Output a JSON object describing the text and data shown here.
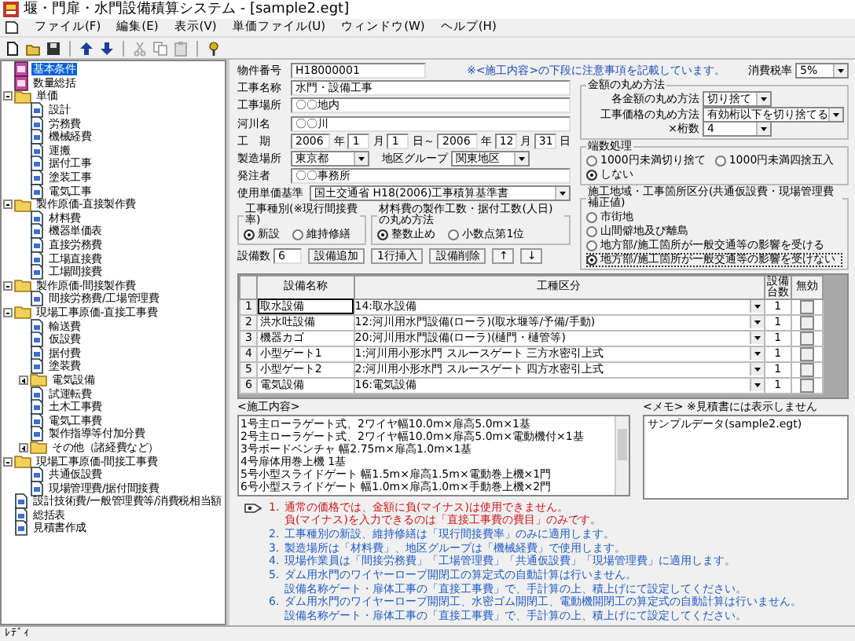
{
  "window": {
    "title": "堰・門扉・水門設備積算システム - [sample2.egt]"
  },
  "menu": [
    "ファイル(F)",
    "編集(E)",
    "表示(V)",
    "単価ファイル(U)",
    "ウィンドウ(W)",
    "ヘルプ(H)"
  ],
  "sidebar": {
    "items": [
      {
        "label": "基本条件",
        "kind": "sheet",
        "selected": true
      },
      {
        "label": "数量総括",
        "kind": "sheet",
        "selected": false
      },
      {
        "label": "単価",
        "kind": "folder",
        "expanded": true,
        "selected": false,
        "children": [
          {
            "label": "設計",
            "kind": "doc",
            "selected": false
          },
          {
            "label": "労務費",
            "kind": "doc",
            "selected": false
          },
          {
            "label": "機械経費",
            "kind": "doc",
            "selected": false
          },
          {
            "label": "運搬",
            "kind": "doc",
            "selected": false
          },
          {
            "label": "据付工事",
            "kind": "doc",
            "selected": false
          },
          {
            "label": "塗装工事",
            "kind": "doc",
            "selected": false
          },
          {
            "label": "電気工事",
            "kind": "doc",
            "selected": false
          }
        ]
      },
      {
        "label": "製作原価-直接製作費",
        "kind": "folder",
        "expanded": true,
        "selected": false,
        "children": [
          {
            "label": "材料費",
            "kind": "doc",
            "selected": false
          },
          {
            "label": "機器単価表",
            "kind": "doc",
            "selected": false
          },
          {
            "label": "直接労務費",
            "kind": "doc",
            "selected": false
          },
          {
            "label": "工場直接費",
            "kind": "doc",
            "selected": false
          },
          {
            "label": "工場間接費",
            "kind": "doc",
            "selected": false
          }
        ]
      },
      {
        "label": "製作原価-間接製作費",
        "kind": "folder",
        "expanded": true,
        "selected": false,
        "children": [
          {
            "label": "間接労務費/工場管理費",
            "kind": "doc",
            "selected": false
          }
        ]
      },
      {
        "label": "現場工事原価-直接工事費",
        "kind": "folder",
        "expanded": true,
        "selected": false,
        "children": [
          {
            "label": "輸送費",
            "kind": "doc",
            "selected": false
          },
          {
            "label": "仮設費",
            "kind": "doc",
            "selected": false
          },
          {
            "label": "据付費",
            "kind": "doc",
            "selected": false
          },
          {
            "label": "塗装費",
            "kind": "doc",
            "selected": false
          },
          {
            "label": "電気設備",
            "kind": "folder",
            "expanded": false,
            "selected": false
          },
          {
            "label": "試運転費",
            "kind": "doc",
            "selected": false
          },
          {
            "label": "土木工事費",
            "kind": "doc",
            "selected": false
          },
          {
            "label": "電気工事費",
            "kind": "doc",
            "selected": false
          },
          {
            "label": "製作指導等付加分費",
            "kind": "doc",
            "selected": false
          },
          {
            "label": "その他（諸経費など）",
            "kind": "folder",
            "expanded": false,
            "selected": false
          }
        ]
      },
      {
        "label": "現場工事原価-間接工事費",
        "kind": "folder",
        "expanded": true,
        "selected": false,
        "children": [
          {
            "label": "共通仮設費",
            "kind": "doc",
            "selected": false
          },
          {
            "label": "現場管理費/据付間接費",
            "kind": "doc",
            "selected": false
          }
        ]
      },
      {
        "label": "設計技術費/一般管理費等/消費税相当額",
        "kind": "doc",
        "selected": false
      },
      {
        "label": "総括表",
        "kind": "doc",
        "selected": false
      },
      {
        "label": "見積書作成",
        "kind": "doc",
        "selected": false
      }
    ]
  },
  "form": {
    "property_no": {
      "label": "物件番号",
      "value": "H18000001"
    },
    "notice": "※<施工内容>の下段に注意事項を記載しています。",
    "fields": [
      {
        "label": "工事名称",
        "value": "水門・設備工事"
      },
      {
        "label": "工事場所",
        "value": "〇〇地内"
      },
      {
        "label": "河川名",
        "value": "〇〇川"
      }
    ],
    "period": {
      "label": "工　期",
      "parts": [
        {
          "kind": "year",
          "text": "2006"
        },
        {
          "kind": "unit",
          "text": "年"
        },
        {
          "kind": "number",
          "text": "1"
        },
        {
          "kind": "unit",
          "text": "月"
        },
        {
          "kind": "number",
          "text": "1"
        },
        {
          "kind": "unit",
          "text": "日～"
        },
        {
          "kind": "year",
          "text": "2006"
        },
        {
          "kind": "unit",
          "text": "年"
        },
        {
          "kind": "number",
          "text": "12"
        },
        {
          "kind": "unit",
          "text": "月"
        },
        {
          "kind": "number",
          "text": "31"
        },
        {
          "kind": "unit",
          "text": "日"
        }
      ]
    },
    "location": {
      "label": "製造場所",
      "value": "東京都"
    },
    "region": {
      "label": "地区グループ",
      "value": "関東地区"
    },
    "client": {
      "label": "発注者",
      "value": "〇〇事務所"
    },
    "standard": {
      "label": "使用単価基準",
      "value": "国土交通省 H18(2006)工事積算基準書"
    },
    "work_type": {
      "title": "工事種別(※現行間接費率)",
      "options": [
        {
          "label": "新設",
          "selected": true
        },
        {
          "label": "維持修繕",
          "selected": false
        }
      ]
    },
    "workday_rounding": {
      "title": "材料費の製作工数・据付工数(人日)の丸め方法",
      "options": [
        {
          "label": "整数止め",
          "selected": true
        },
        {
          "label": "小数点第1位",
          "selected": false
        }
      ]
    }
  },
  "settings": {
    "tax": {
      "label": "消費税率",
      "value": "5%"
    },
    "rounding": {
      "title": "金額の丸め方法",
      "rows": [
        {
          "label": "各金額の丸め方法",
          "value": "切り捨て"
        },
        {
          "label": "工事価格の丸め方法",
          "value": "有効桁以下を切り捨てる"
        },
        {
          "label": "×桁数",
          "value": "4"
        }
      ]
    },
    "fraction": {
      "title": "端数処理",
      "options": [
        {
          "label": "1000円未満切り捨て",
          "selected": false
        },
        {
          "label": "1000円未満四捨五入",
          "selected": false
        },
        {
          "label": "しない",
          "selected": true
        }
      ]
    },
    "area": {
      "title": "施工地域・工事箇所区分(共通仮設費・現場管理費補正値)",
      "options": [
        {
          "label": "市街地",
          "selected": false
        },
        {
          "label": "山間僻地及び離島",
          "selected": false
        },
        {
          "label": "地方部/施工箇所が一般交通等の影響を受ける",
          "selected": false
        },
        {
          "label": "地方部/施工箇所が一般交通等の影響を受けない",
          "selected": true
        }
      ]
    }
  },
  "equipment": {
    "count_label": "設備数",
    "count": "6",
    "buttons": [
      "設備追加",
      "1行挿入",
      "設備削除",
      "↑",
      "↓"
    ],
    "columns": [
      "設備名称",
      "工種区分",
      "設備台数",
      "無効"
    ],
    "rows": [
      {
        "no": "1",
        "name": "取水設備",
        "type": "14:取水設備",
        "qty": "1",
        "checked": false,
        "selected": true
      },
      {
        "no": "2",
        "name": "洪水吐設備",
        "type": "12:河川用水門設備(ローラ)(取水堰等/予備/手動)",
        "qty": "1",
        "checked": false,
        "selected": false
      },
      {
        "no": "3",
        "name": "機器カゴ",
        "type": "20:河川用水門設備(ローラ)(樋門・樋管等)",
        "qty": "1",
        "checked": false,
        "selected": false
      },
      {
        "no": "4",
        "name": "小型ゲート1",
        "type": "1:河川用小形水門 スルースゲート 三方水密引上式",
        "qty": "1",
        "checked": false,
        "selected": false
      },
      {
        "no": "5",
        "name": "小型ゲート2",
        "type": "2:河川用小形水門 スルースゲート 四方水密引上式",
        "qty": "1",
        "checked": false,
        "selected": false
      },
      {
        "no": "6",
        "name": "電気設備",
        "type": "16:電気設備",
        "qty": "1",
        "checked": false,
        "selected": false
      }
    ]
  },
  "construction": {
    "label": "<施工内容>",
    "lines": [
      "1号主ローラゲート式、2ワイヤ幅10.0m×扉高5.0m×1基",
      "2号主ローラゲート式、2ワイヤ幅10.0m×扉高5.0m×電動機付×1基",
      "3号ボードベンチャ 幅2.75m×扉高1.0m×1基",
      "4号扉体用巻上機 1基",
      "5号小型スライドゲート 幅1.5m×扉高1.5m×電動巻上機×1門",
      "6号小型スライドゲート 幅1.0m×扉高1.0m×手動巻上機×2門"
    ]
  },
  "memo": {
    "label": "<メモ> ※見積書には表示しません",
    "text": "サンプルデータ(sample2.egt)"
  },
  "notes": [
    {
      "kind": "warning",
      "number": "1.",
      "lines": [
        "通常の価格では、金額に負(マイナス)は使用できません。",
        "負(マイナス)を入力できるのは「直接工事費の費目」のみです。"
      ]
    },
    {
      "kind": "info",
      "number": "2.",
      "lines": [
        "工事種別の新設、維持修繕は「現行間接費率」のみに適用します。"
      ]
    },
    {
      "kind": "info",
      "number": "3.",
      "lines": [
        "製造場所は「材料費」、地区グループは「機械経費」で使用します。"
      ]
    },
    {
      "kind": "info",
      "number": "4.",
      "lines": [
        "現場作業員は「間接労務費」「工場管理費」「共通仮設費」「現場管理費」に適用します。"
      ]
    },
    {
      "kind": "info",
      "number": "5.",
      "lines": [
        "ダム用水門のワイヤーロープ開閉工の算定式の自動計算は行いません。",
        "設備名称ゲート・扉体工事の「直接工事費」で、手計算の上、積上げにて設定してください。"
      ]
    },
    {
      "kind": "info",
      "number": "6.",
      "lines": [
        "ダム用水門のワイヤーロープ開閉工、水密ゴム開閉工、電動機開閉工の算定式の自動計算は行いません。",
        "設備名称ゲート・扉体工事の「直接工事費」で、手計算の上、積上げにて設定してください。"
      ]
    }
  ],
  "status_bar": "ﾚﾃﾞｨ"
}
